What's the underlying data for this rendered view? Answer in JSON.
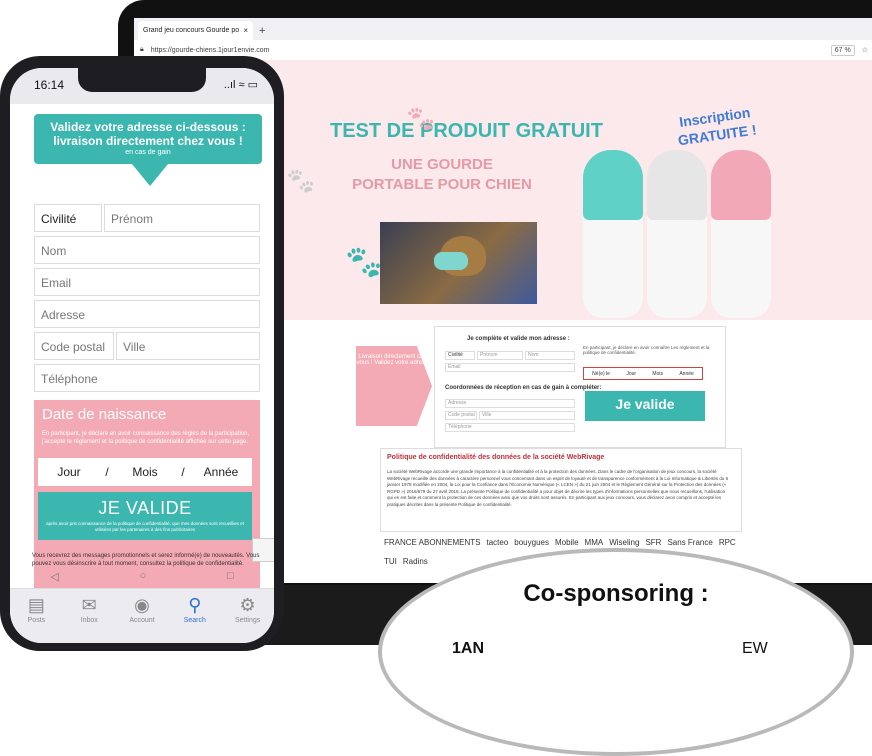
{
  "browser": {
    "tab_title": "Grand jeu concours Gourde po",
    "tab_close": "×",
    "new_tab": "+",
    "url": "https://gourde-chiens.1jour1envie.com",
    "zoom": "67 %"
  },
  "site": {
    "title": "TEST DE PRODUIT GRATUIT",
    "subtitle": "UNE GOURDE PORTABLE POUR CHIEN",
    "inscription": "Inscription GRATUITE !",
    "arrow_text": "Livraison directement chez vous ! Validez votre adresse",
    "form_heading": "Je complète et valide mon adresse :",
    "civilite": "Civilité",
    "prenom": "Prénom",
    "nom": "Nom",
    "email": "Email",
    "coord_heading": "Coordonnées de réception en cas de gain à compléter:",
    "adresse": "Adresse",
    "code_postal": "Code postal",
    "ville": "Ville",
    "telephone": "Téléphone",
    "legal_right": "En participant, je déclare en avoir connaître Les règlement et la politique de confidentialité.",
    "date": {
      "nes": "Né(e) le",
      "jour": "Jour",
      "mois": "Mois",
      "annee": "Année"
    },
    "valide": "Je valide",
    "privacy_title": "Politique de confidentialité des données de la société WebRivage",
    "privacy_text": "La société WebRivage accorde une grande importance à la confidentialité et à la protection des données. Dans le cadre de l'organisation de jeux concours, la société WebRivage recueille des données à caractère personnel vous concernant dans un esprit de loyauté et de transparence conformément à la Loi Informatique & Libertés du 6 janvier 1978 modifiée en 2004, la Loi pour la Confiance dans l'Économie Numérique (« LCEN ») du 21 juin 2004 et le Règlement Général sur la Protection des données (« RGPD ») 2016/679 du 27 avril 2016. La présente Politique de confidentialité a pour objet de décrire les types d'informations personnelles que nous recueillons, l'utilisation qui en est faite et comment la protection de ces données ainsi que vos droits sont assurés. En participant aux jeux concours, vous déclarez avoir compris et accepté les pratiques décrites dans la présente Politique de confidentialité.",
    "logos": [
      "FRANCE ABONNEMENTS",
      "tacteo",
      "bouygues",
      "Mobile",
      "MMA",
      "Wiseling",
      "SFR",
      "Sans France",
      "RPC",
      "TUI",
      "Radins"
    ]
  },
  "phone": {
    "time": "16:14",
    "status_icons": "..ıl ≈ ▭",
    "banner_line1": "Validez votre adresse ci-dessous : livraison directement chez vous !",
    "banner_line2": "en cas de gain",
    "civilite": "Civilité",
    "prenom": "Prénom",
    "nom": "Nom",
    "email": "Email",
    "adresse": "Adresse",
    "code_postal": "Code postal",
    "ville": "Ville",
    "telephone": "Téléphone",
    "birth_title": "Date de naissance",
    "birth_desc": "En participant, je déclare en avoir connaissance des règles de la participation, j'accepte le règlement et la politique de confidentialité affichée sur cette page.",
    "jour": "Jour",
    "sep": "/",
    "mois": "Mois",
    "annee": "Année",
    "valide": "JE VALIDE",
    "valide_sub": "après avoir pris connaissance de la politique de confidentialité, que mes données sont recueillies et utilisées par les partenaires à des fins publicitaires",
    "fine_print": "Vous recevrez des messages promotionnels et serez informé(e) de nouveautés. Vous pouvez vous désinscrire à tout moment, consultez la politique de confidentialité.",
    "nav": {
      "back": "◁",
      "home": "○",
      "recent": "□"
    },
    "tabs": [
      {
        "icon": "▤",
        "label": "Posts"
      },
      {
        "icon": "✉",
        "label": "Inbox"
      },
      {
        "icon": "◉",
        "label": "Account"
      },
      {
        "icon": "⚲",
        "label": "Search"
      },
      {
        "icon": "⚙",
        "label": "Settings"
      }
    ]
  },
  "cosponsoring": {
    "title": "Co-sponsoring :",
    "logo1": "1AN",
    "logo2": "EW"
  },
  "colors": {
    "teal": "#3bb7b0",
    "pink": "#f4aab4",
    "blue": "#3f7bd4",
    "red": "#c0303a"
  }
}
